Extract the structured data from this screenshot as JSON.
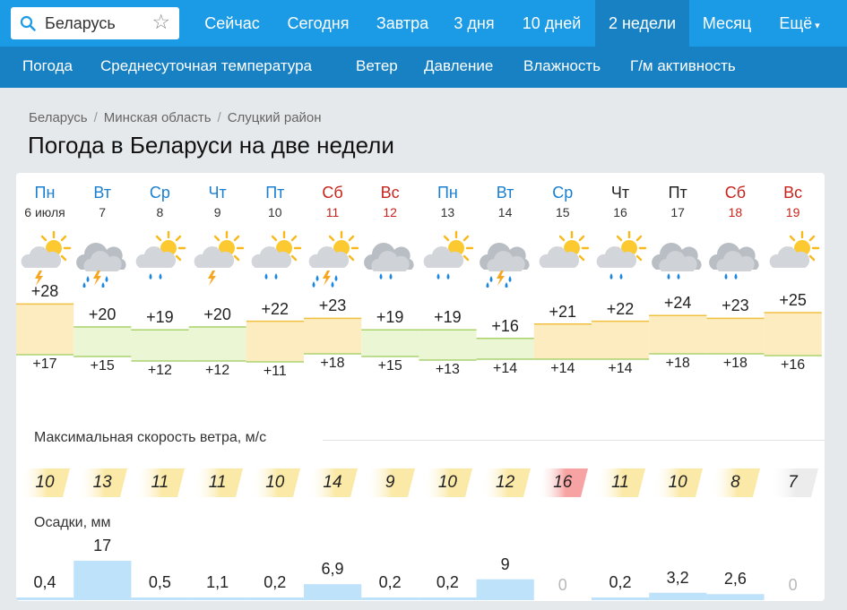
{
  "search": {
    "value": "Беларусь",
    "icon": "search-icon",
    "fav_icon": "star-icon"
  },
  "nav": [
    "Сейчас",
    "Сегодня",
    "Завтра",
    "3 дня",
    "10 дней",
    "2 недели",
    "Месяц",
    "Ещё"
  ],
  "nav_active": "2 недели",
  "subnav": [
    "Погода",
    "Среднесуточная температура",
    "Ветер",
    "Давление",
    "Влажность",
    "Г/м активность"
  ],
  "breadcrumb": [
    "Беларусь",
    "Минская область",
    "Слуцкий район"
  ],
  "title": "Погода в Беларуси на две недели",
  "wind_title": "Максимальная скорость ветра, м/с",
  "precip_title": "Осадки, мм",
  "colors": {
    "nav": "#1b9be6",
    "subnav": "#1781c4",
    "weekend": "#c8231c",
    "weekday": "#1b7fd0",
    "wind_warn": "#f7a3a3",
    "wind": "#fbe9a8",
    "wind_calm": "#ececec",
    "precip": "#bfe2fb",
    "temp_warm": "#fcecc0",
    "temp_cool": "#eaf6d4"
  },
  "days": [
    {
      "name": "Пн",
      "date": "6 июля",
      "type": "wkday",
      "icon": "partly-cloudy-thunder-icon",
      "max": "+28",
      "min": "+17",
      "wind": "10",
      "wind_level": "normal",
      "precip": "0,4",
      "precip_mm": 0.4
    },
    {
      "name": "Вт",
      "date": "7",
      "type": "wkday",
      "icon": "cloudy-rain-thunder-icon",
      "max": "+20",
      "min": "+15",
      "wind": "13",
      "wind_level": "normal",
      "precip": "17",
      "precip_mm": 17
    },
    {
      "name": "Ср",
      "date": "8",
      "type": "wkday",
      "icon": "partly-cloudy-rain-icon",
      "max": "+19",
      "min": "+12",
      "wind": "11",
      "wind_level": "normal",
      "precip": "0,5",
      "precip_mm": 0.5
    },
    {
      "name": "Чт",
      "date": "9",
      "type": "wkday",
      "icon": "partly-cloudy-thunder-icon",
      "max": "+20",
      "min": "+12",
      "wind": "11",
      "wind_level": "normal",
      "precip": "1,1",
      "precip_mm": 1.1
    },
    {
      "name": "Пт",
      "date": "10",
      "type": "wkday",
      "icon": "partly-cloudy-rain-icon",
      "max": "+22",
      "min": "+11",
      "wind": "10",
      "wind_level": "normal",
      "precip": "0,2",
      "precip_mm": 0.2
    },
    {
      "name": "Сб",
      "date": "11",
      "type": "wkend",
      "icon": "partly-cloudy-rain-thunder-icon",
      "max": "+23",
      "min": "+18",
      "wind": "14",
      "wind_level": "normal",
      "precip": "6,9",
      "precip_mm": 6.9
    },
    {
      "name": "Вс",
      "date": "12",
      "type": "wkend",
      "icon": "cloudy-rain-icon",
      "max": "+19",
      "min": "+15",
      "wind": "9",
      "wind_level": "normal",
      "precip": "0,2",
      "precip_mm": 0.2
    },
    {
      "name": "Пн",
      "date": "13",
      "type": "wkday",
      "icon": "partly-cloudy-rain-icon",
      "max": "+19",
      "min": "+13",
      "wind": "10",
      "wind_level": "normal",
      "precip": "0,2",
      "precip_mm": 0.2
    },
    {
      "name": "Вт",
      "date": "14",
      "type": "wkday",
      "icon": "cloudy-rain-thunder-icon",
      "max": "+16",
      "min": "+14",
      "wind": "12",
      "wind_level": "normal",
      "precip": "9",
      "precip_mm": 9
    },
    {
      "name": "Ср",
      "date": "15",
      "type": "wkday",
      "icon": "partly-cloudy-icon",
      "max": "+21",
      "min": "+14",
      "wind": "16",
      "wind_level": "high",
      "precip": "0",
      "precip_mm": 0
    },
    {
      "name": "Чт",
      "date": "16",
      "type": "plain",
      "icon": "partly-cloudy-rain-icon",
      "max": "+22",
      "min": "+14",
      "wind": "11",
      "wind_level": "normal",
      "precip": "0,2",
      "precip_mm": 0.2
    },
    {
      "name": "Пт",
      "date": "17",
      "type": "plain",
      "icon": "cloudy-rain-icon",
      "max": "+24",
      "min": "+18",
      "wind": "10",
      "wind_level": "normal",
      "precip": "3,2",
      "precip_mm": 3.2
    },
    {
      "name": "Сб",
      "date": "18",
      "type": "wkend",
      "icon": "cloudy-rain-icon",
      "max": "+23",
      "min": "+18",
      "wind": "8",
      "wind_level": "normal",
      "precip": "2,6",
      "precip_mm": 2.6
    },
    {
      "name": "Вс",
      "date": "19",
      "type": "wkend",
      "icon": "partly-cloudy-icon",
      "max": "+25",
      "min": "+16",
      "wind": "7",
      "wind_level": "low",
      "precip": "0",
      "precip_mm": 0
    }
  ]
}
